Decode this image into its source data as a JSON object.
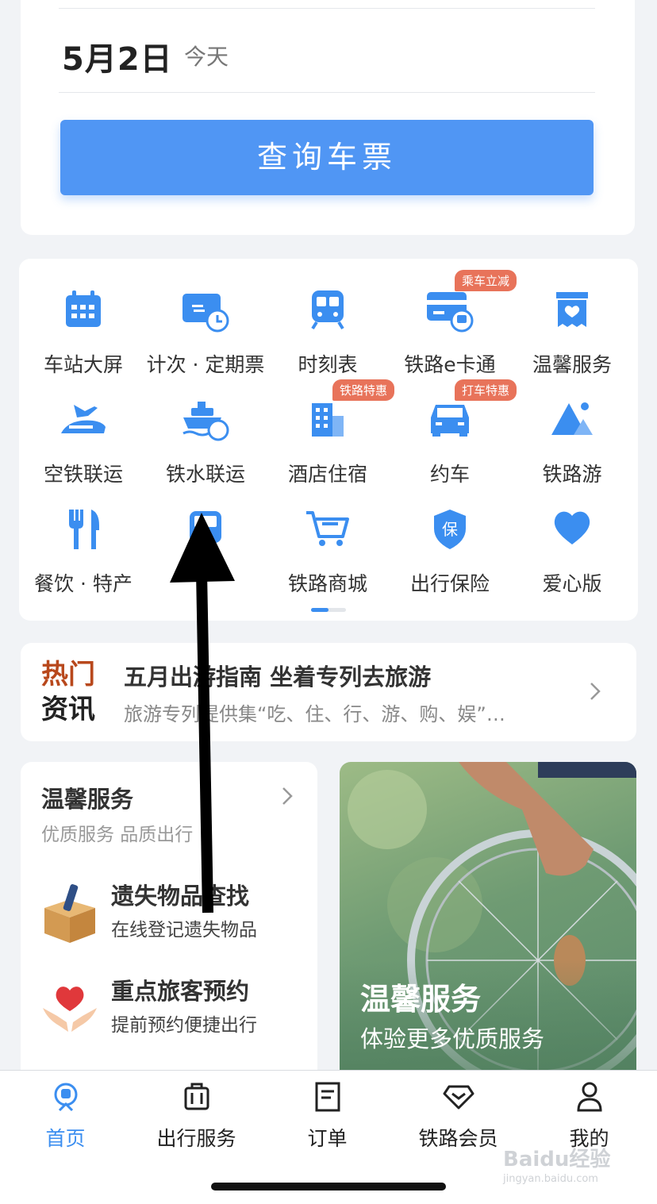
{
  "search": {
    "date": "5月2日",
    "date_sub": "今天",
    "query_button": "查询车票"
  },
  "services_grid": {
    "tiles": [
      {
        "label": "车站大屏",
        "icon": "calendar-icon",
        "tag": ""
      },
      {
        "label": "计次 · 定期票",
        "icon": "ticket-clock-icon",
        "tag": ""
      },
      {
        "label": "时刻表",
        "icon": "train-icon",
        "tag": ""
      },
      {
        "label": "铁路e卡通",
        "icon": "card-train-icon",
        "tag": "乘车立减"
      },
      {
        "label": "温馨服务",
        "icon": "heart-box-icon",
        "tag": ""
      },
      {
        "label": "空铁联运",
        "icon": "plane-train-icon",
        "tag": ""
      },
      {
        "label": "铁水联运",
        "icon": "ship-train-icon",
        "tag": ""
      },
      {
        "label": "酒店住宿",
        "icon": "hotel-icon",
        "tag": "铁路特惠"
      },
      {
        "label": "约车",
        "icon": "car-icon",
        "tag": "打车特惠"
      },
      {
        "label": "铁路游",
        "icon": "mountain-icon",
        "tag": ""
      },
      {
        "label": "餐饮 · 特产",
        "icon": "fork-knife-icon",
        "tag": ""
      },
      {
        "label": "",
        "icon": "bus-icon",
        "tag": ""
      },
      {
        "label": "铁路商城",
        "icon": "cart-icon",
        "tag": ""
      },
      {
        "label": "出行保险",
        "icon": "shield-icon",
        "tag": ""
      },
      {
        "label": "爱心版",
        "icon": "heart-icon",
        "tag": ""
      }
    ],
    "pager": {
      "pages": 2,
      "current": 1
    }
  },
  "news": {
    "logo_line1": "热门",
    "logo_line2": "资讯",
    "title": "五月出游指南 坐着专列去旅游",
    "subtitle": "旅游专列提供集“吃、住、行、游、购、娱”…"
  },
  "warm_service": {
    "title": "温馨服务",
    "subtitle": "优质服务 品质出行",
    "items": [
      {
        "title": "遗失物品查找",
        "subtitle": "在线登记遗失物品",
        "icon": "box-icon"
      },
      {
        "title": "重点旅客预约",
        "subtitle": "提前预约便捷出行",
        "icon": "heart-hands-icon"
      }
    ]
  },
  "banner": {
    "title": "温馨服务",
    "subtitle": "体验更多优质服务"
  },
  "tabbar": {
    "tabs": [
      {
        "label": "首页",
        "icon": "home-train-icon",
        "active": true
      },
      {
        "label": "出行服务",
        "icon": "luggage-icon",
        "active": false
      },
      {
        "label": "订单",
        "icon": "document-icon",
        "active": false
      },
      {
        "label": "铁路会员",
        "icon": "diamond-icon",
        "active": false
      },
      {
        "label": "我的",
        "icon": "user-icon",
        "active": false
      }
    ]
  },
  "watermark": {
    "text": "Baidu经验",
    "sub": "jingyan.baidu.com"
  },
  "colors": {
    "accent": "#3b8ef0",
    "button": "#5096f4",
    "tag": "#e8735a"
  }
}
